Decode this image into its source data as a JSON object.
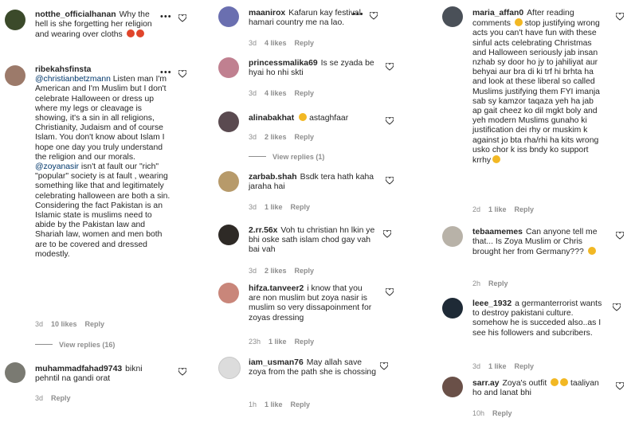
{
  "col1": {
    "c1": {
      "username": "notthe_officialhanan",
      "text": "Why the hell is she forgetting her religion and wearing over cloths"
    },
    "c2": {
      "username": "ribekahsfinsta",
      "mention": "@christianbetzmann",
      "text": " Listen man I'm American and I'm Muslim but I don't celebrate Halloween or dress up where my legs or cleavage is showing, it's a sin in all religions, Christianity, Judaism and of course Islam. You don't know about Islam I hope one day you truly understand the religion and our morals. ",
      "mention2": "@zoyanasir",
      "text2": " isn't at fault our \"rich\" \"popular\" society is at fault , wearing something like that and legitimately celebrating halloween are both a sin. Considering the fact Pakistan is an Islamic state is muslims need to abide by the Pakistan law and Shariah law, women and men both are to be covered and dressed modestly.",
      "time": "3d",
      "likes": "10 likes",
      "reply": "Reply",
      "view_replies": "View replies (16)"
    },
    "c3": {
      "username": "muhammadfahad9743",
      "text": "bikni pehntil na gandi orat",
      "time": "3d",
      "reply": "Reply"
    }
  },
  "col2": {
    "c1": {
      "username": "maanirox",
      "text": "Kafarun kay festival hamari country me na lao.",
      "time": "3d",
      "likes": "4 likes",
      "reply": "Reply"
    },
    "c2": {
      "username": "princessmalika69",
      "text": "Is se zyada be hyai ho nhi skti",
      "time": "3d",
      "likes": "4 likes",
      "reply": "Reply"
    },
    "c3": {
      "username": "alinabakhat",
      "text": "astaghfaar",
      "time": "3d",
      "likes": "2 likes",
      "reply": "Reply",
      "view_replies": "View replies (1)"
    },
    "c4": {
      "username": "zarbab.shah",
      "text": "Bsdk tera hath kaha jaraha hai",
      "time": "3d",
      "likes": "1 like",
      "reply": "Reply"
    },
    "c5": {
      "username": "2.rr.56x",
      "text": "Voh tu christian hn lkin ye bhi oske sath islam chod gay vah bai vah",
      "time": "3d",
      "likes": "2 likes",
      "reply": "Reply"
    },
    "c6": {
      "username": "hifza.tanveer2",
      "text": "i know that you are non muslim but zoya nasir is muslim so very dissapoinment for zoyas dressing",
      "time": "23h",
      "likes": "1 like",
      "reply": "Reply"
    },
    "c7": {
      "username": "iam_usman76",
      "text": "May allah save zoya from the path she is chossing",
      "time": "1h",
      "likes": "1 like",
      "reply": "Reply"
    }
  },
  "col3": {
    "c1": {
      "username": "maria_affan0",
      "text_a": "After reading comments ",
      "text_b": " stop justifying wrong acts you can't have fun with these sinful acts celebrating Christmas and Halloween seriously jab insan nzhab sy door ho jy to jahiliyat aur behyai aur bra di ki trf hi brhta ha and look at these liberal so called Muslims justifying them FYI imanja sab sy kamzor taqaza yeh ha jab ap gait cheez ko dil mgkt boly and yeh modern Muslims gunaho ki justification dei rhy or muskim k against jo bta rha/rhi ha kits wrong usko chor k iss bndy ko support krrhy",
      "time": "2d",
      "likes": "1 like",
      "reply": "Reply"
    },
    "c2": {
      "username": "tebaamemes",
      "text": "Can anyone tell me that... Is Zoya Muslim or Chris brought her from Germany???",
      "time": "2h",
      "reply": "Reply"
    },
    "c3": {
      "username": "leee_1932",
      "text": "a germanterrorist wants to destroy pakistani culture. somehow he is succeded also..as I see his followers and subcribers.",
      "time": "3d",
      "likes": "1 like",
      "reply": "Reply"
    },
    "c4": {
      "username": "sarr.ay",
      "text_a": "Zoya's outfit ",
      "text_b": " taaliyan ho and lanat bhi",
      "time": "10h",
      "reply": "Reply"
    }
  },
  "icons": {
    "dots": "•••",
    "heart": "heart-outline-icon"
  },
  "colors": {
    "text": "#262626",
    "meta": "#8e8e8e",
    "mention": "#00376b"
  }
}
